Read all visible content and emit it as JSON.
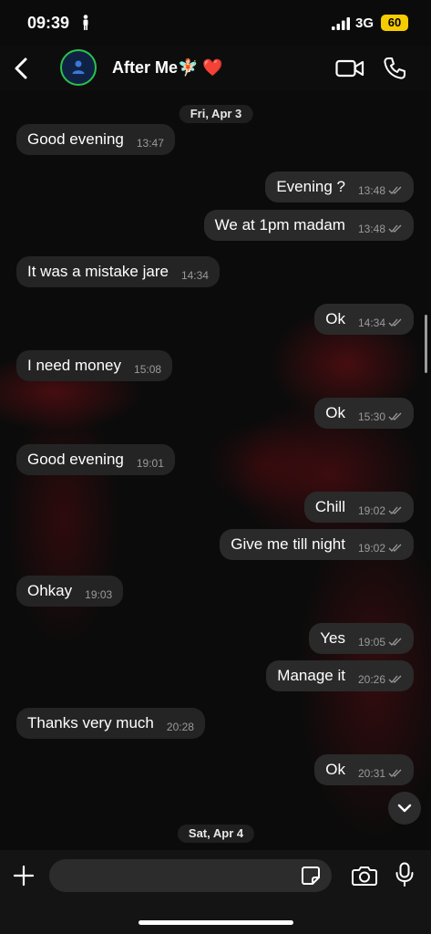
{
  "status_bar": {
    "time": "09:39",
    "network": "3G",
    "battery": "60"
  },
  "header": {
    "contact_name": "After Me🧚🏻 ❤️"
  },
  "chat": {
    "date_separators": [
      {
        "label": "Fri, Apr 3"
      },
      {
        "label": "Sat, Apr 4"
      }
    ],
    "messages": [
      {
        "text": "Good evening",
        "time": "13:47",
        "direction": "in"
      },
      {
        "text": "Evening ?",
        "time": "13:48",
        "direction": "out"
      },
      {
        "text": "We at 1pm madam",
        "time": "13:48",
        "direction": "out"
      },
      {
        "text": "It was a mistake jare",
        "time": "14:34",
        "direction": "in"
      },
      {
        "text": "Ok",
        "time": "14:34",
        "direction": "out"
      },
      {
        "text": "I need money",
        "time": "15:08",
        "direction": "in"
      },
      {
        "text": "Ok",
        "time": "15:30",
        "direction": "out"
      },
      {
        "text": "Good evening",
        "time": "19:01",
        "direction": "in"
      },
      {
        "text": "Chill",
        "time": "19:02",
        "direction": "out"
      },
      {
        "text": "Give me till night",
        "time": "19:02",
        "direction": "out"
      },
      {
        "text": "Ohkay",
        "time": "19:03",
        "direction": "in"
      },
      {
        "text": "Yes",
        "time": "19:05",
        "direction": "out"
      },
      {
        "text": "Manage it",
        "time": "20:26",
        "direction": "out"
      },
      {
        "text": "Thanks very much",
        "time": "20:28",
        "direction": "in"
      },
      {
        "text": "Ok",
        "time": "20:31",
        "direction": "out"
      }
    ]
  },
  "input_bar": {
    "placeholder": ""
  },
  "colors": {
    "avatar_ring": "#2bc24a",
    "battery": "#f5cc00",
    "bubble": "#242424"
  }
}
